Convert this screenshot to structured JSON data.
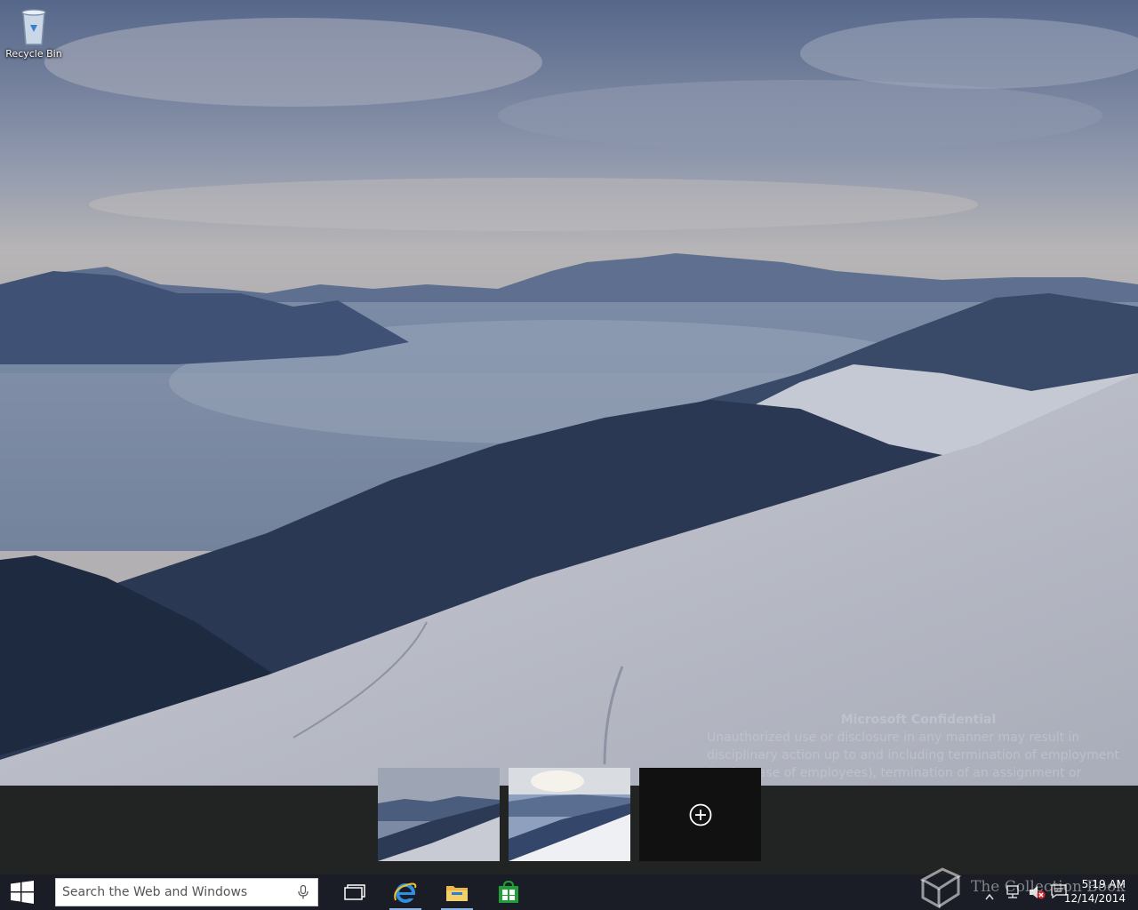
{
  "desktop": {
    "icons": [
      {
        "label": "Recycle Bin"
      }
    ]
  },
  "watermark": {
    "title": "Microsoft Confidential",
    "body": "Unauthorized use or disclosure in any manner may result in disciplinary action up to and including termination of employment (in the case of employees), termination of an assignment or contract (in the case of",
    "logo_text": "The Collection Book"
  },
  "task_view": {
    "desktops": [
      {
        "name": "desktop-1"
      },
      {
        "name": "desktop-2"
      }
    ]
  },
  "taskbar": {
    "search_placeholder": "Search the Web and Windows",
    "apps": [
      "Task View",
      "Internet Explorer",
      "File Explorer",
      "Store"
    ],
    "clock": {
      "time": "5:19 AM",
      "date": "12/14/2014"
    }
  },
  "colors": {
    "taskbar_bg": "#1a1d26",
    "taskview_bg": "#222222",
    "accent": "#8cb4e6",
    "store_green": "#1e9f3a"
  }
}
